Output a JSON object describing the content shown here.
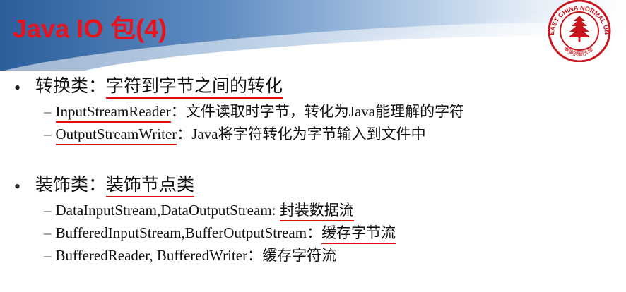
{
  "slide": {
    "title": "Java IO 包(4)",
    "logo": {
      "text_top": "EAST CHINA NORMAL UNIVERSITY",
      "text_bottom": "華東師範大學"
    }
  },
  "sections": [
    {
      "label": "转换类：",
      "highlight": "字符到字节之间的转化",
      "items": [
        {
          "term": "InputStreamReader",
          "sep": "：",
          "desc": "文件读取时字节，转化为Java能理解的字符"
        },
        {
          "term": "OutputStreamWriter",
          "sep": "：",
          "desc": "Java将字符转化为字节输入到文件中"
        }
      ]
    },
    {
      "label": "装饰类：",
      "highlight": "装饰节点类",
      "items": [
        {
          "term": "DataInputStream,DataOutputStream:",
          "sep": " ",
          "desc": "封装数据流"
        },
        {
          "term": "BufferedInputStream,BufferOutputStream",
          "sep": "：",
          "desc": "缓存字节流"
        },
        {
          "term": "BufferedReader, BufferedWriter",
          "sep": "：",
          "desc": "缓存字符流"
        }
      ]
    }
  ],
  "colors": {
    "title": "#e8121f",
    "underline": "#dd1111"
  }
}
